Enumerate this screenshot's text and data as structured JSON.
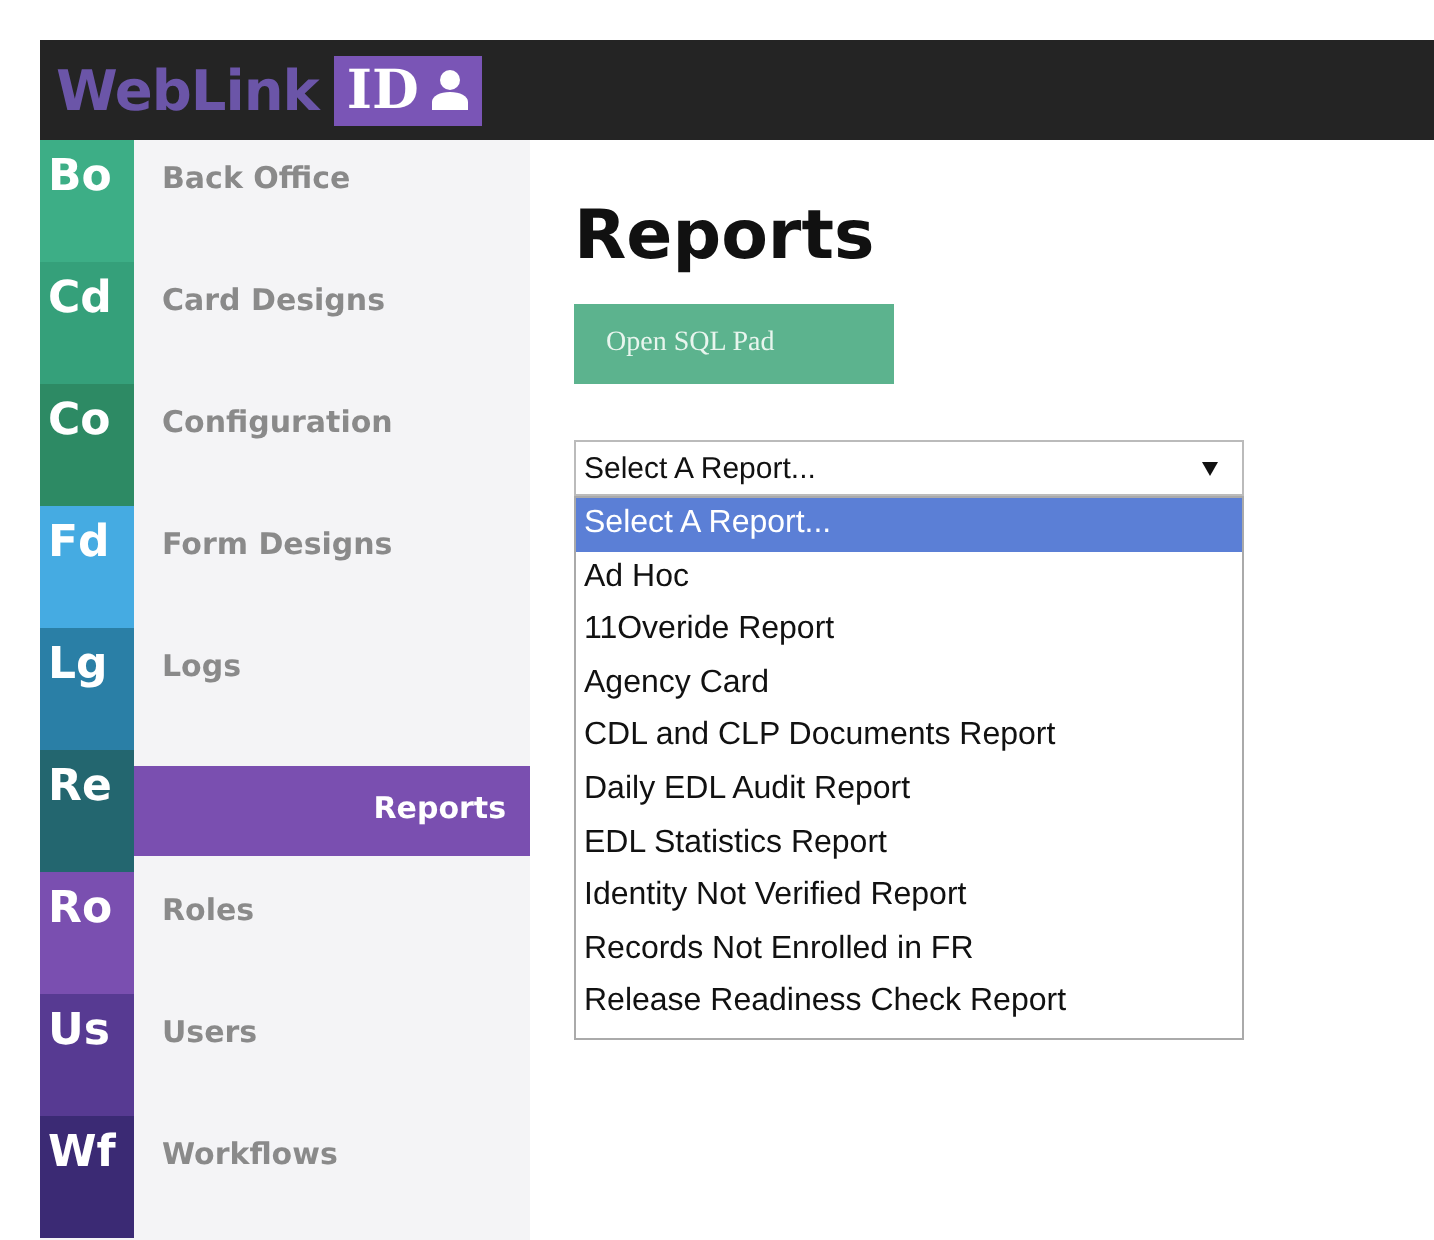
{
  "header": {
    "brand": "WebLink",
    "badge": "ID"
  },
  "sidebar": {
    "items": [
      {
        "abbr": "Bo",
        "label": "Back Office",
        "color": "#3dae86",
        "selected": false
      },
      {
        "abbr": "Cd",
        "label": "Card Designs",
        "color": "#35a07a",
        "selected": false
      },
      {
        "abbr": "Co",
        "label": "Configuration",
        "color": "#2d8a64",
        "selected": false
      },
      {
        "abbr": "Fd",
        "label": "Form Designs",
        "color": "#45abe2",
        "selected": false
      },
      {
        "abbr": "Lg",
        "label": "Logs",
        "color": "#2a7fa6",
        "selected": false
      },
      {
        "abbr": "Re",
        "label": "Reports",
        "color": "#23666f",
        "selected": true
      },
      {
        "abbr": "Ro",
        "label": "Roles",
        "color": "#7a4fb0",
        "selected": false
      },
      {
        "abbr": "Us",
        "label": "Users",
        "color": "#573a92",
        "selected": false
      },
      {
        "abbr": "Wf",
        "label": "Workflows",
        "color": "#3b2a74",
        "selected": false
      }
    ]
  },
  "main": {
    "title": "Reports",
    "button": "Open SQL Pad",
    "select": {
      "value": "Select A Report...",
      "expanded": true,
      "options": [
        {
          "label": "Select A Report...",
          "selected": true
        },
        {
          "label": "Ad Hoc",
          "selected": false
        },
        {
          "label": "11Overide Report",
          "selected": false
        },
        {
          "label": "Agency Card",
          "selected": false
        },
        {
          "label": "CDL and CLP Documents Report",
          "selected": false
        },
        {
          "label": "Daily EDL Audit Report",
          "selected": false
        },
        {
          "label": "EDL Statistics Report",
          "selected": false
        },
        {
          "label": "Identity Not Verified Report",
          "selected": false
        },
        {
          "label": "Records Not Enrolled in FR",
          "selected": false
        },
        {
          "label": "Release Readiness Check Report",
          "selected": false
        }
      ]
    }
  }
}
